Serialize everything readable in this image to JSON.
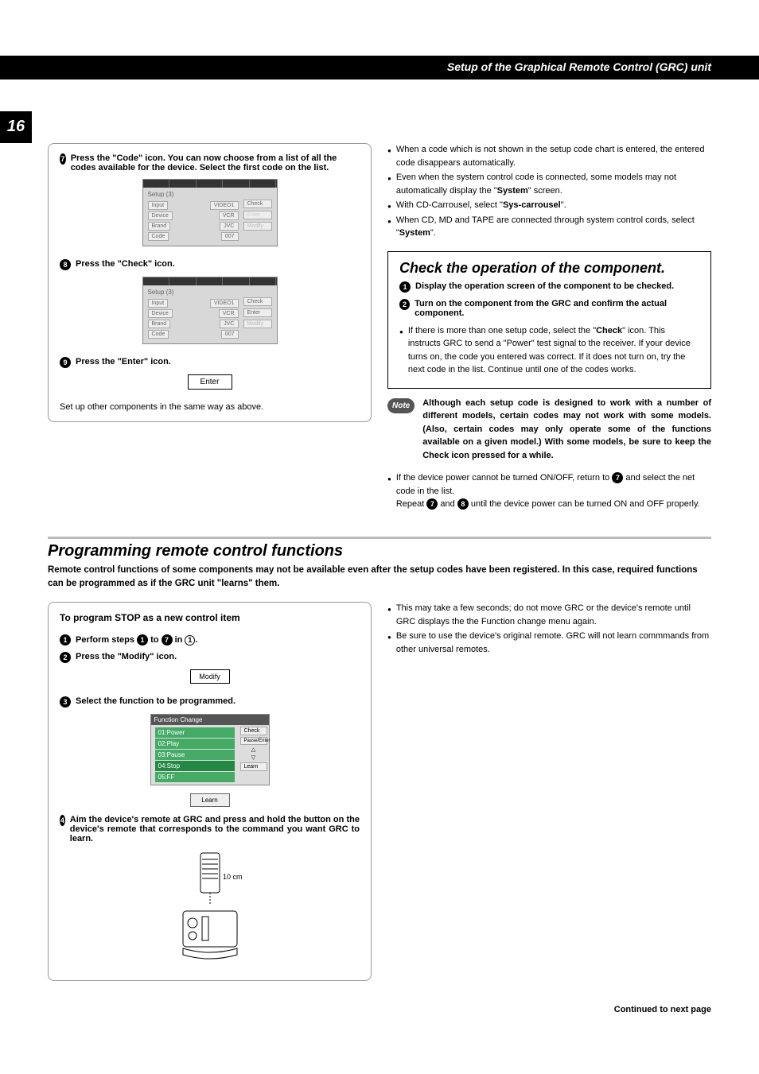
{
  "header": {
    "title": "Setup of the Graphical Remote Control (GRC) unit",
    "page_number": "16"
  },
  "left_col": {
    "step7_label": "7",
    "step7_text": "Press the \"Code\" icon.  You can now choose from a list of all the codes available for the device.  Select the first code on the list.",
    "ss1": {
      "title": "Setup (3)",
      "rows": [
        {
          "k": "Input",
          "v": "VIDEO1"
        },
        {
          "k": "Device",
          "v": "VCR"
        },
        {
          "k": "Brand",
          "v": "JVC"
        },
        {
          "k": "Code",
          "v": "007"
        }
      ],
      "right_buttons": [
        "Check",
        "Enter",
        "Modify"
      ]
    },
    "step8_label": "8",
    "step8_text": "Press the \"Check\" icon.",
    "step9_label": "9",
    "step9_text": "Press the \"Enter\" icon.",
    "enter_button": "Enter",
    "footnote": "Set up other components in the same way as above."
  },
  "right_col": {
    "bullets_top": [
      {
        "t": "When a code which is not shown in the setup code chart is entered, the entered code disappears automatically."
      },
      {
        "t_pre": "Even when the system control code is connected, some models may not automatically display the \"",
        "bold": "System",
        "t_post": "\" screen."
      },
      {
        "t_pre": "With CD-Carrousel, select \"",
        "bold": "Sys-carrousel",
        "t_post": "\"."
      },
      {
        "t_pre": "When CD, MD and TAPE are connected through system control cords, select \"",
        "bold": "System",
        "t_post": "\"."
      }
    ],
    "check_section": {
      "title": "Check the operation of the component.",
      "s1_label": "1",
      "s1": "Display the operation screen of the component to be checked.",
      "s2_label": "2",
      "s2": "Turn on the component from the GRC and confirm the actual component.",
      "bullet_pre": "If there is more than one setup code, select the \"",
      "bullet_bold": "Check",
      "bullet_post": "\" icon. This instructs GRC to send a \"Power\" test signal to the receiver. If your device turns on, the code you entered was correct.  If it does not turn on, try the next code in the list.  Continue until one of the codes works."
    },
    "note_label": "Note",
    "note_text": "Although each setup code is designed to work with a number of different models, certain codes may not work with some models.  (Also, certain codes may only operate some of the functions available on a given model.) With some models, be sure to keep the Check icon pressed for a while.",
    "after_note_bullet": {
      "line1_pre": "If the device power cannot be turned ON/OFF, return to ",
      "line1_ref": "7",
      "line1_post": " and select the net code in the list.",
      "line2_pre": "Repeat ",
      "line2_a": "7",
      "line2_mid": " and ",
      "line2_b": "8",
      "line2_post": " until the device power can be turned ON and OFF properly."
    }
  },
  "programming": {
    "title": "Programming remote control functions",
    "intro": "Remote control functions of some components may not be available even after the setup codes have been registered. In this case, required functions can be programmed as if the GRC unit \"learns\" them.",
    "box_title": "To program STOP as a new control item",
    "s1_label": "1",
    "s1_pre": "Perform steps ",
    "s1_a": "1",
    "s1_mid": " to ",
    "s1_b": "7",
    "s1_mid2": " in ",
    "s1_ref": "1",
    "s1_post": ".",
    "s2_label": "2",
    "s2": "Press the \"Modify\" icon.",
    "modify_btn": "Modify",
    "s3_label": "3",
    "s3": "Select the function to be programmed.",
    "func_list_title": "Function Change",
    "func_list": [
      "01:Power",
      "02:Play",
      "03:Pause",
      "04:Stop",
      "05:FF"
    ],
    "func_right": [
      "Check",
      "Pause/Enter",
      "Learn"
    ],
    "learn_btn": "Learn",
    "s4_label": "4",
    "s4": "Aim the device's remote at GRC and press and hold the button on the device's remote that corresponds to the command you want GRC to learn.",
    "distance": "10 cm",
    "right_bullets": [
      "This may take a few seconds; do not move GRC or the device's remote until GRC displays the the Function change menu again.",
      "Be sure to use the device's original remote.  GRC will not learn commmands from other universal remotes."
    ]
  },
  "footer": {
    "continued": "Continued to next page"
  }
}
